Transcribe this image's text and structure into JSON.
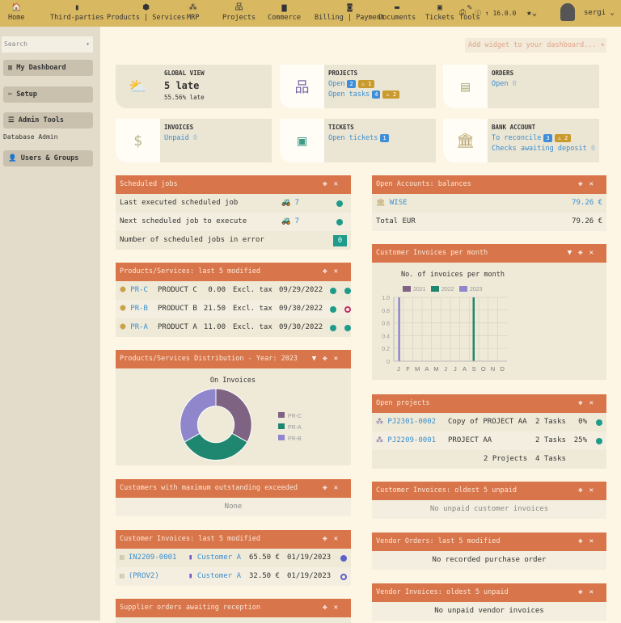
{
  "topbar": {
    "menus": [
      {
        "label": "Home",
        "icon": "home-icon",
        "g": "🏠"
      },
      {
        "label": "Third-parties",
        "icon": "building-icon",
        "g": "▮"
      },
      {
        "label": "Products | Services",
        "icon": "cube-icon",
        "g": "⬢"
      },
      {
        "label": "MRP",
        "icon": "cubes-icon",
        "g": "⁂"
      },
      {
        "label": "Projects",
        "icon": "sitemap-icon",
        "g": "品"
      },
      {
        "label": "Commerce",
        "icon": "briefcase-icon",
        "g": "▆"
      },
      {
        "label": "Billing | Payment",
        "icon": "money-icon",
        "g": "◙"
      },
      {
        "label": "Documents",
        "icon": "folder-icon",
        "g": "▬"
      },
      {
        "label": "Tickets",
        "icon": "ticket-icon",
        "g": "▣"
      },
      {
        "label": "Tools",
        "icon": "wrench-icon",
        "g": "✎"
      }
    ],
    "version": "16.0.0",
    "user": "sergi"
  },
  "sidebar": {
    "search_placeholder": "Search",
    "items": [
      "My Dashboard",
      "Setup",
      "Admin Tools",
      "Database Admin",
      "Users & Groups"
    ]
  },
  "add_widget": "Add widget to your dashboard...",
  "cards": {
    "global": {
      "title": "GLOBAL VIEW",
      "value": "5 late",
      "sub": "55.56% late"
    },
    "projects": {
      "title": "PROJECTS",
      "open": "Open",
      "open_n": "2",
      "open_w": "1",
      "tasks": "Open tasks",
      "tasks_n": "4",
      "tasks_w": "2"
    },
    "orders": {
      "title": "ORDERS",
      "open": "Open",
      "open_n": "0"
    },
    "invoices": {
      "title": "INVOICES",
      "unpaid": "Unpaid",
      "unpaid_n": "0"
    },
    "tickets": {
      "title": "TICKETS",
      "open": "Open tickets",
      "open_n": "1"
    },
    "bank": {
      "title": "BANK ACCOUNT",
      "rec": "To reconcile",
      "rec_n": "3",
      "rec_w": "2",
      "chk": "Checks awaiting deposit",
      "chk_n": "0"
    }
  },
  "sched": {
    "title": "Scheduled jobs",
    "rows": [
      {
        "label": "Last executed scheduled job",
        "n": "7"
      },
      {
        "label": "Next scheduled job to execute",
        "n": "7"
      },
      {
        "label": "Number of scheduled jobs in error",
        "n": "0"
      }
    ]
  },
  "products": {
    "title": "Products/Services: last 5 modified",
    "rows": [
      {
        "ref": "PR-C",
        "name": "PRODUCT C",
        "price": "0.00",
        "tax": "Excl. tax",
        "date": "09/29/2022"
      },
      {
        "ref": "PR-B",
        "name": "PRODUCT B",
        "price": "21.50",
        "tax": "Excl. tax",
        "date": "09/30/2022"
      },
      {
        "ref": "PR-A",
        "name": "PRODUCT A",
        "price": "11.00",
        "tax": "Excl. tax",
        "date": "09/30/2022"
      }
    ]
  },
  "dist": {
    "title": "Products/Services Distribution - Year: 2023"
  },
  "maxout": {
    "title": "Customers with maximum outstanding exceeded",
    "empty": "None"
  },
  "custinv": {
    "title": "Customer Invoices: last 5 modified",
    "rows": [
      {
        "ref": "IN2209-0001",
        "cust": "Customer A",
        "amt": "65.50 €",
        "date": "01/19/2023"
      },
      {
        "ref": "(PROV2)",
        "cust": "Customer A",
        "amt": "32.50 €",
        "date": "01/19/2023"
      }
    ]
  },
  "supplier": {
    "title": "Supplier orders awaiting reception"
  },
  "accounts": {
    "title": "Open Accounts: balances",
    "bank": "WISE",
    "bank_amt": "79.26 €",
    "total": "Total EUR",
    "total_amt": "79.26 €"
  },
  "permonth": {
    "title": "Customer Invoices per month"
  },
  "openproj": {
    "title": "Open projects",
    "rows": [
      {
        "ref": "PJ2301-0002",
        "name": "Copy of PROJECT AA",
        "tasks": "2 Tasks",
        "pct": "0%"
      },
      {
        "ref": "PJ2209-0001",
        "name": "PROJECT AA",
        "tasks": "2 Tasks",
        "pct": "25%"
      }
    ],
    "total_p": "2 Projects",
    "total_t": "4 Tasks"
  },
  "oldunpaid": {
    "title": "Customer Invoices: oldest 5 unpaid",
    "empty": "No unpaid customer invoices"
  },
  "vorders": {
    "title": "Vendor Orders: last 5 modified",
    "empty": "No recorded purchase order"
  },
  "vinv": {
    "title": "Vendor Invoices: oldest 5 unpaid",
    "empty": "No unpaid vendor invoices"
  },
  "chart_data": [
    {
      "type": "pie",
      "title": "On Invoices",
      "categories": [
        "PR-C",
        "PR-A",
        "PR-B"
      ],
      "values": [
        1,
        1,
        1
      ],
      "colors": [
        "#7e6383",
        "#1f8670",
        "#8f86cc"
      ]
    },
    {
      "type": "bar",
      "title": "No. of invoices per month",
      "categories": [
        "J",
        "F",
        "M",
        "A",
        "M",
        "J",
        "J",
        "A",
        "S",
        "O",
        "N",
        "D"
      ],
      "ylim": [
        0,
        1
      ],
      "yticks": [
        "0",
        "0.2",
        "0.4",
        "0.6",
        "0.8",
        "1.0"
      ],
      "series": [
        {
          "name": "2021",
          "color": "#7e6383",
          "values": [
            0,
            0,
            0,
            0,
            0,
            0,
            0,
            0,
            0,
            0,
            0,
            0
          ]
        },
        {
          "name": "2022",
          "color": "#1f8670",
          "values": [
            0,
            0,
            0,
            0,
            0,
            0,
            0,
            0,
            1,
            0,
            0,
            0
          ]
        },
        {
          "name": "2023",
          "color": "#8f86cc",
          "values": [
            1,
            0,
            0,
            0,
            0,
            0,
            0,
            0,
            0,
            0,
            0,
            0
          ]
        }
      ]
    }
  ]
}
